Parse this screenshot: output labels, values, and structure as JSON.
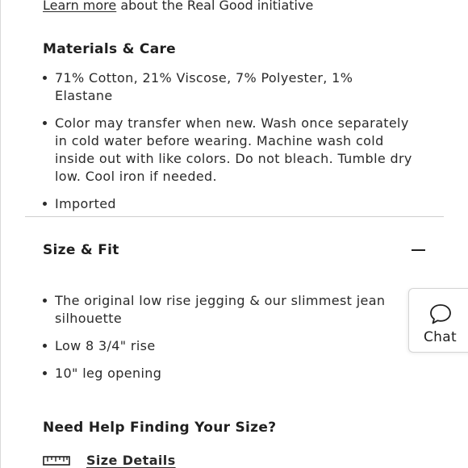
{
  "initiative": {
    "link_text": "Learn more",
    "rest_text": " about the Real Good initiative"
  },
  "materials": {
    "title": "Materials & Care",
    "items": [
      "71% Cotton, 21% Viscose, 7% Polyester, 1% Elastane",
      "Color may transfer when new. Wash once separately in cold water before wearing. Machine wash cold inside out with like colors. Do not bleach. Tumble dry low. Cool iron if needed.",
      "Imported"
    ]
  },
  "size_fit": {
    "title": "Size & Fit",
    "toggle_icon": "minus-icon",
    "items": [
      "The original low rise jegging & our slimmest jean silhouette",
      "Low 8 3/4\" rise",
      "10\" leg opening"
    ]
  },
  "help": {
    "title": "Need Help Finding Your Size?",
    "link_text": "Size Details",
    "link_icon": "ruler-icon"
  },
  "chat": {
    "label": "Chat",
    "icon": "chat-bubble-icon"
  },
  "colors": {
    "text": "#1f1f1f",
    "divider": "#cfcfcf"
  }
}
